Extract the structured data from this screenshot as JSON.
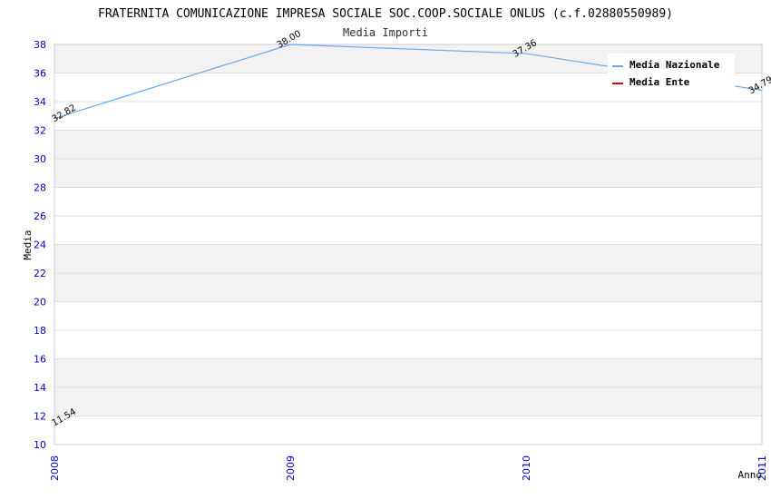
{
  "chart_data": {
    "type": "line",
    "title": "FRATERNITA COMUNICAZIONE IMPRESA SOCIALE SOC.COOP.SOCIALE ONLUS (c.f.02880550989)",
    "subtitle": "Media Importi",
    "xlabel": "Anno",
    "ylabel": "Media",
    "categories": [
      "2008",
      "2009",
      "2010",
      "2011"
    ],
    "ylim": [
      10,
      38
    ],
    "yticks": [
      10,
      12,
      14,
      16,
      18,
      20,
      22,
      24,
      26,
      28,
      30,
      32,
      34,
      36,
      38
    ],
    "grid": true,
    "legend_position": "top-right",
    "series": [
      {
        "name": "Media Nazionale",
        "color": "#66aaee",
        "values": [
          32.82,
          38.0,
          37.36,
          34.79
        ],
        "labels": [
          "32.82",
          "38.00",
          "37.36",
          "34.79"
        ]
      },
      {
        "name": "Media Ente",
        "color": "#dd0000",
        "values": [
          11.54,
          null,
          null,
          null
        ],
        "labels": [
          "11.54",
          "",
          "",
          ""
        ]
      }
    ]
  }
}
